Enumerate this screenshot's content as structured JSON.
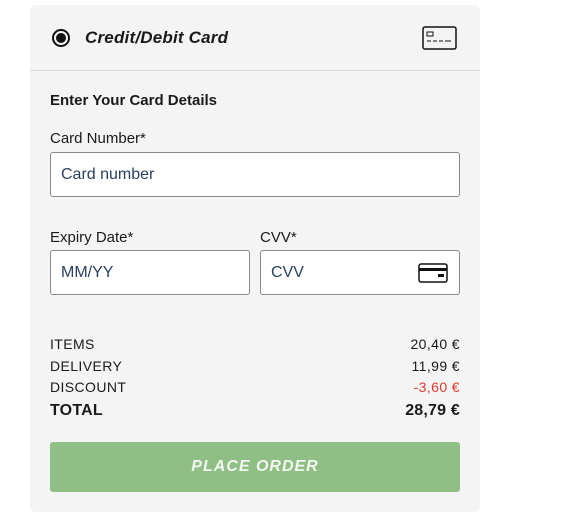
{
  "payment_method": {
    "label": "Credit/Debit Card",
    "selected": true,
    "icon": "credit-card-icon"
  },
  "form": {
    "section_title": "Enter Your Card Details",
    "card_number": {
      "label": "Card Number*",
      "placeholder": "Card number",
      "value": ""
    },
    "expiry": {
      "label": "Expiry Date*",
      "placeholder": "MM/YY",
      "value": ""
    },
    "cvv": {
      "label": "CVV*",
      "placeholder": "CVV",
      "value": "",
      "icon": "card-back-icon"
    }
  },
  "summary": {
    "items": {
      "label": "ITEMS",
      "value": "20,40 €"
    },
    "delivery": {
      "label": "DELIVERY",
      "value": "11,99 €"
    },
    "discount": {
      "label": "DISCOUNT",
      "value": "-3,60 €"
    },
    "total": {
      "label": "TOTAL",
      "value": "28,79 €"
    }
  },
  "actions": {
    "place_order_label": "PLACE ORDER"
  },
  "colors": {
    "panel_bg": "#f4f4f4",
    "button_bg": "#8fbf85",
    "discount": "#e03a2f"
  }
}
